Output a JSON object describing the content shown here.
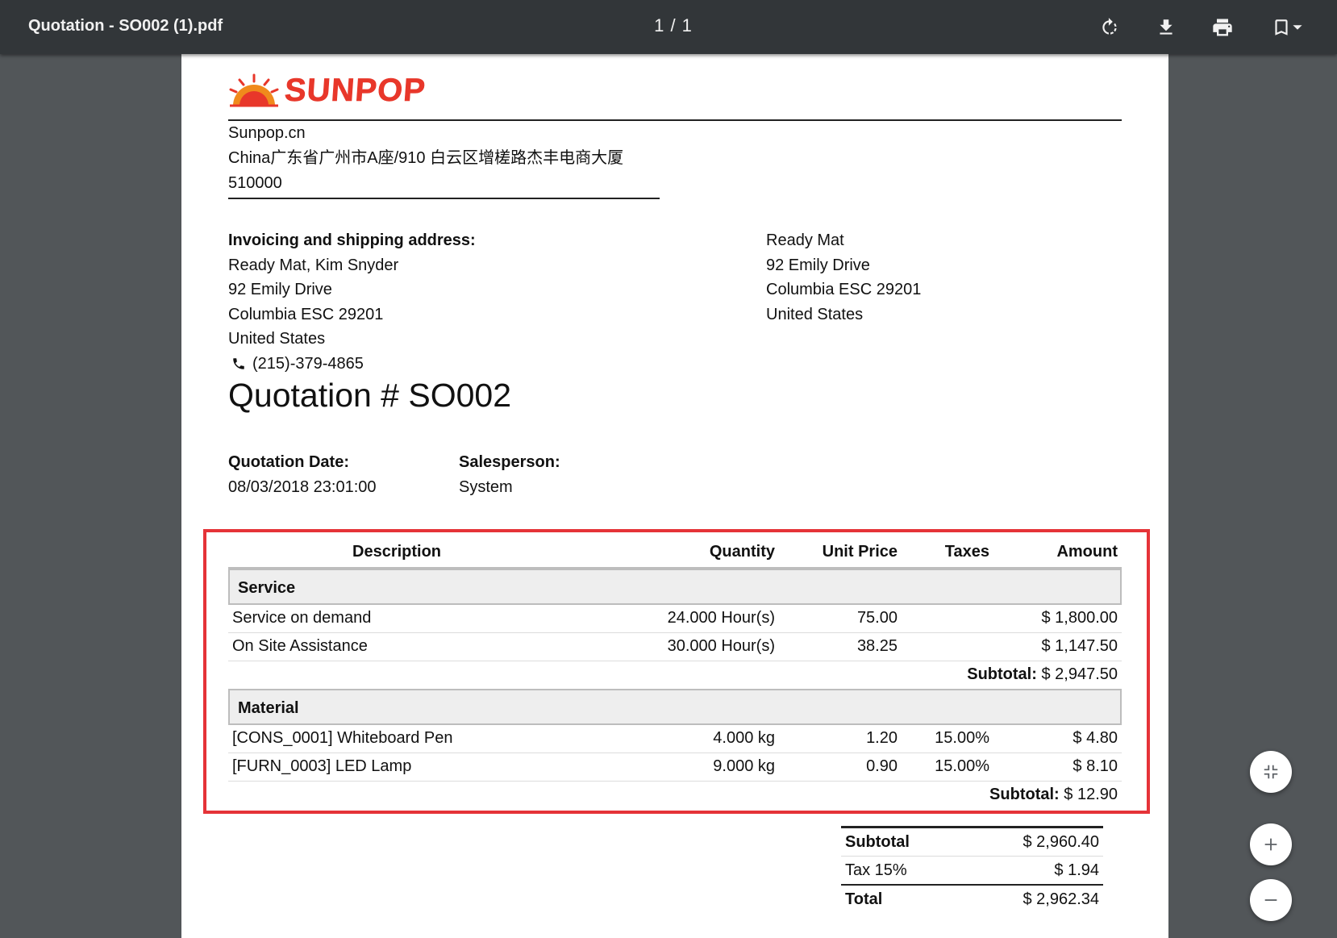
{
  "viewer": {
    "file_title": "Quotation - SO002 (1).pdf",
    "page_indicator": "1 / 1",
    "icons": [
      "rotate-icon",
      "download-icon",
      "print-icon",
      "bookmark-icon",
      "fit-page-icon",
      "zoom-in-icon",
      "zoom-out-icon"
    ]
  },
  "company": {
    "logo_text": "SUNPOP",
    "website": "Sunpop.cn",
    "address_line": "China广东省广州市A座/910 白云区增槎路杰丰电商大厦",
    "postcode": "510000"
  },
  "invoice_address": {
    "heading": "Invoicing and shipping address:",
    "name": "Ready Mat, Kim Snyder",
    "street": "92 Emily Drive",
    "city": "Columbia ESC 29201",
    "country": "United States",
    "phone": "(215)-379-4865"
  },
  "partner_address": {
    "name": "Ready Mat",
    "street": "92 Emily Drive",
    "city": "Columbia ESC 29201",
    "country": "United States"
  },
  "quotation": {
    "title": "Quotation # SO002",
    "date_label": "Quotation Date:",
    "date_value": "08/03/2018 23:01:00",
    "salesperson_label": "Salesperson:",
    "salesperson_value": "System"
  },
  "table": {
    "headers": {
      "description": "Description",
      "quantity": "Quantity",
      "unit_price": "Unit Price",
      "taxes": "Taxes",
      "amount": "Amount"
    },
    "sections": [
      {
        "name": "Service",
        "lines": [
          {
            "description": "Service on demand",
            "quantity": "24.000 Hour(s)",
            "unit_price": "75.00",
            "taxes": "",
            "amount": "$ 1,800.00"
          },
          {
            "description": "On Site Assistance",
            "quantity": "30.000 Hour(s)",
            "unit_price": "38.25",
            "taxes": "",
            "amount": "$ 1,147.50"
          }
        ],
        "subtotal_label": "Subtotal:",
        "subtotal_value": "$ 2,947.50"
      },
      {
        "name": "Material",
        "lines": [
          {
            "description": "[CONS_0001] Whiteboard Pen",
            "quantity": "4.000 kg",
            "unit_price": "1.20",
            "taxes": "15.00%",
            "amount": "$ 4.80"
          },
          {
            "description": "[FURN_0003] LED Lamp",
            "quantity": "9.000 kg",
            "unit_price": "0.90",
            "taxes": "15.00%",
            "amount": "$ 8.10"
          }
        ],
        "subtotal_label": "Subtotal:",
        "subtotal_value": "$ 12.90"
      }
    ],
    "highlight_color": "#e53338"
  },
  "totals": {
    "subtotal_label": "Subtotal",
    "subtotal_value": "$ 2,960.40",
    "tax_label": "Tax 15%",
    "tax_value": "$ 1.94",
    "total_label": "Total",
    "total_value": "$ 2,962.34"
  },
  "colors": {
    "toolbar": "#323639",
    "background": "#525659",
    "brand": "#e8372a"
  }
}
